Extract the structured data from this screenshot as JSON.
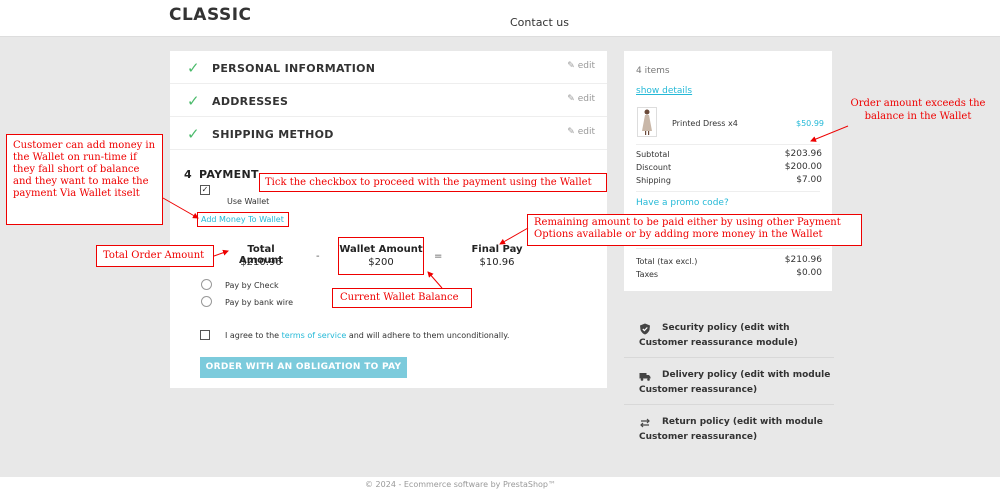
{
  "header": {
    "logo": "CLASSIC",
    "contact": "Contact us"
  },
  "steps": [
    {
      "title": "PERSONAL INFORMATION",
      "edit": "edit"
    },
    {
      "title": "ADDRESSES",
      "edit": "edit"
    },
    {
      "title": "SHIPPING METHOD",
      "edit": "edit"
    }
  ],
  "payment": {
    "number": "4",
    "title": "PAYMENT",
    "use_wallet_label": "Use Wallet",
    "use_wallet_checked": true,
    "add_money_link": "Add Money To Wallet",
    "total_amount_label": "Total Amount",
    "total_amount_value": "$210.96",
    "minus": "-",
    "wallet_amount_label": "Wallet Amount",
    "wallet_amount_value": "$200",
    "equals": "=",
    "final_pay_label": "Final Pay",
    "final_pay_value": "$10.96",
    "options": [
      "Pay by Check",
      "Pay by bank wire"
    ],
    "terms_prefix": "I agree to the",
    "terms_link": "terms of service",
    "terms_suffix": "and will adhere to them unconditionally.",
    "order_button": "ORDER WITH AN OBLIGATION TO PAY"
  },
  "cart": {
    "items_count": "4 items",
    "show_details": "show details",
    "product_name": "Printed Dress x4",
    "product_price": "$50.99",
    "subtotal_label": "Subtotal",
    "subtotal_value": "$203.96",
    "discount_label": "Discount",
    "discount_value": "$200.00",
    "shipping_label": "Shipping",
    "shipping_value": "$7.00",
    "promo_link": "Have a promo code?",
    "total_label": "Total (tax excl.)",
    "total_value": "$210.96",
    "taxes_label": "Taxes",
    "taxes_value": "$0.00"
  },
  "reassurance": [
    {
      "icon": "shield-icon",
      "line1": "Security policy (edit with",
      "line2": "Customer reassurance module)"
    },
    {
      "icon": "truck-icon",
      "line1": "Delivery policy (edit with module",
      "line2": "Customer reassurance)"
    },
    {
      "icon": "swap-arrows-icon",
      "line1": "Return policy (edit with module",
      "line2": "Customer reassurance)"
    }
  ],
  "annotations": {
    "add_money": "Customer can add money in the Wallet on run-time if they fall short of balance and they want to make the payment Via Wallet itselt",
    "checkbox": "Tick the checkbox to proceed with the payment using the Wallet",
    "remaining": "Remaining amount to be paid either by using  other Payment Options available or by adding more money in the Wallet",
    "total_order": "Total Order Amount",
    "wallet_balance": "Current Wallet Balance",
    "exceeds": "Order amount exceeds the balance in the Wallet"
  },
  "footer": {
    "text": "© 2024 - Ecommerce software by PrestaShop™"
  },
  "colors": {
    "accent": "#25b9d7",
    "check": "#4cbb6c",
    "annotation": "#ee0000",
    "button": "#7ccbdc"
  }
}
